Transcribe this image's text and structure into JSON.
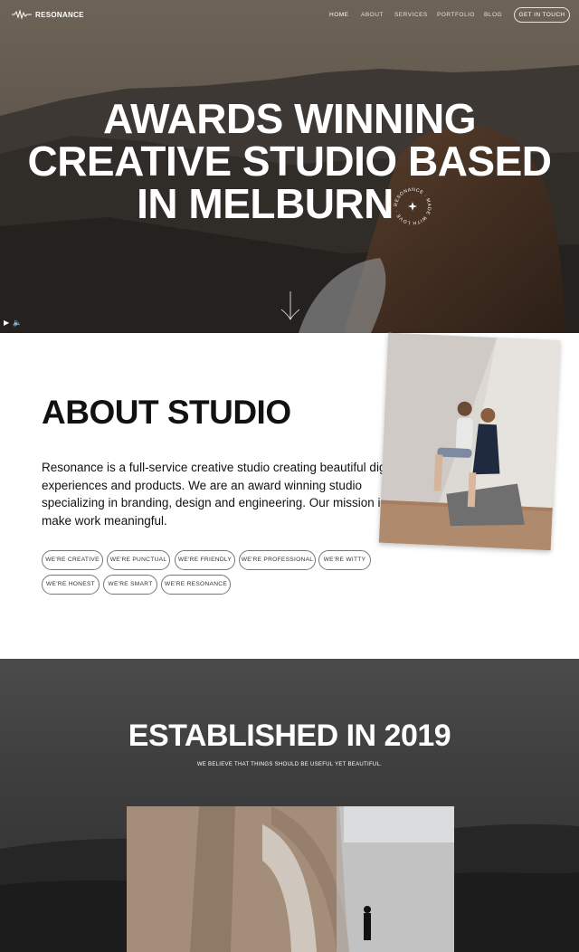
{
  "nav": {
    "brand": "RESONANCE",
    "links": [
      "HOME",
      "ABOUT",
      "SERVICES",
      "PORTFOLIO",
      "BLOG"
    ],
    "cta": "GET IN TOUCH"
  },
  "hero": {
    "title_lines": [
      "AWARDS WINNING",
      "CREATIVE STUDIO BASED",
      "IN MELBURN"
    ],
    "badge_text": "RESONANCE · MADE WITH LOVE ·"
  },
  "about": {
    "title": "ABOUT STUDIO",
    "text": "Resonance is a full-service creative studio creating beautiful digital experiences and products. We are an award winning studio specializing in branding, design and engineering. Our mission is to make work meaningful.",
    "tags": [
      "WE'RE CREATIVE",
      "WE'RE PUNCTUAL",
      "WE'RE FRIENDLY",
      "WE'RE PROFESSIONAL",
      "WE'RE WITTY",
      "WE'RE HONEST",
      "WE'RE SMART",
      "WE'RE RESONANCE"
    ]
  },
  "established": {
    "title": "ESTABLISHED IN 2019",
    "subtitle": "WE BELIEVE THAT THINGS SHOULD BE USEFUL YET BEAUTIFUL."
  },
  "icons": {
    "logo": "waveform-icon",
    "badge_star": "sparkle-icon",
    "play": "play-icon",
    "volume": "volume-icon",
    "scroll": "scroll-down-icon"
  },
  "colors": {
    "hero_bg": "#3a3630",
    "established_bg": "#3c3c3c",
    "text": "#111111",
    "white": "#ffffff"
  }
}
